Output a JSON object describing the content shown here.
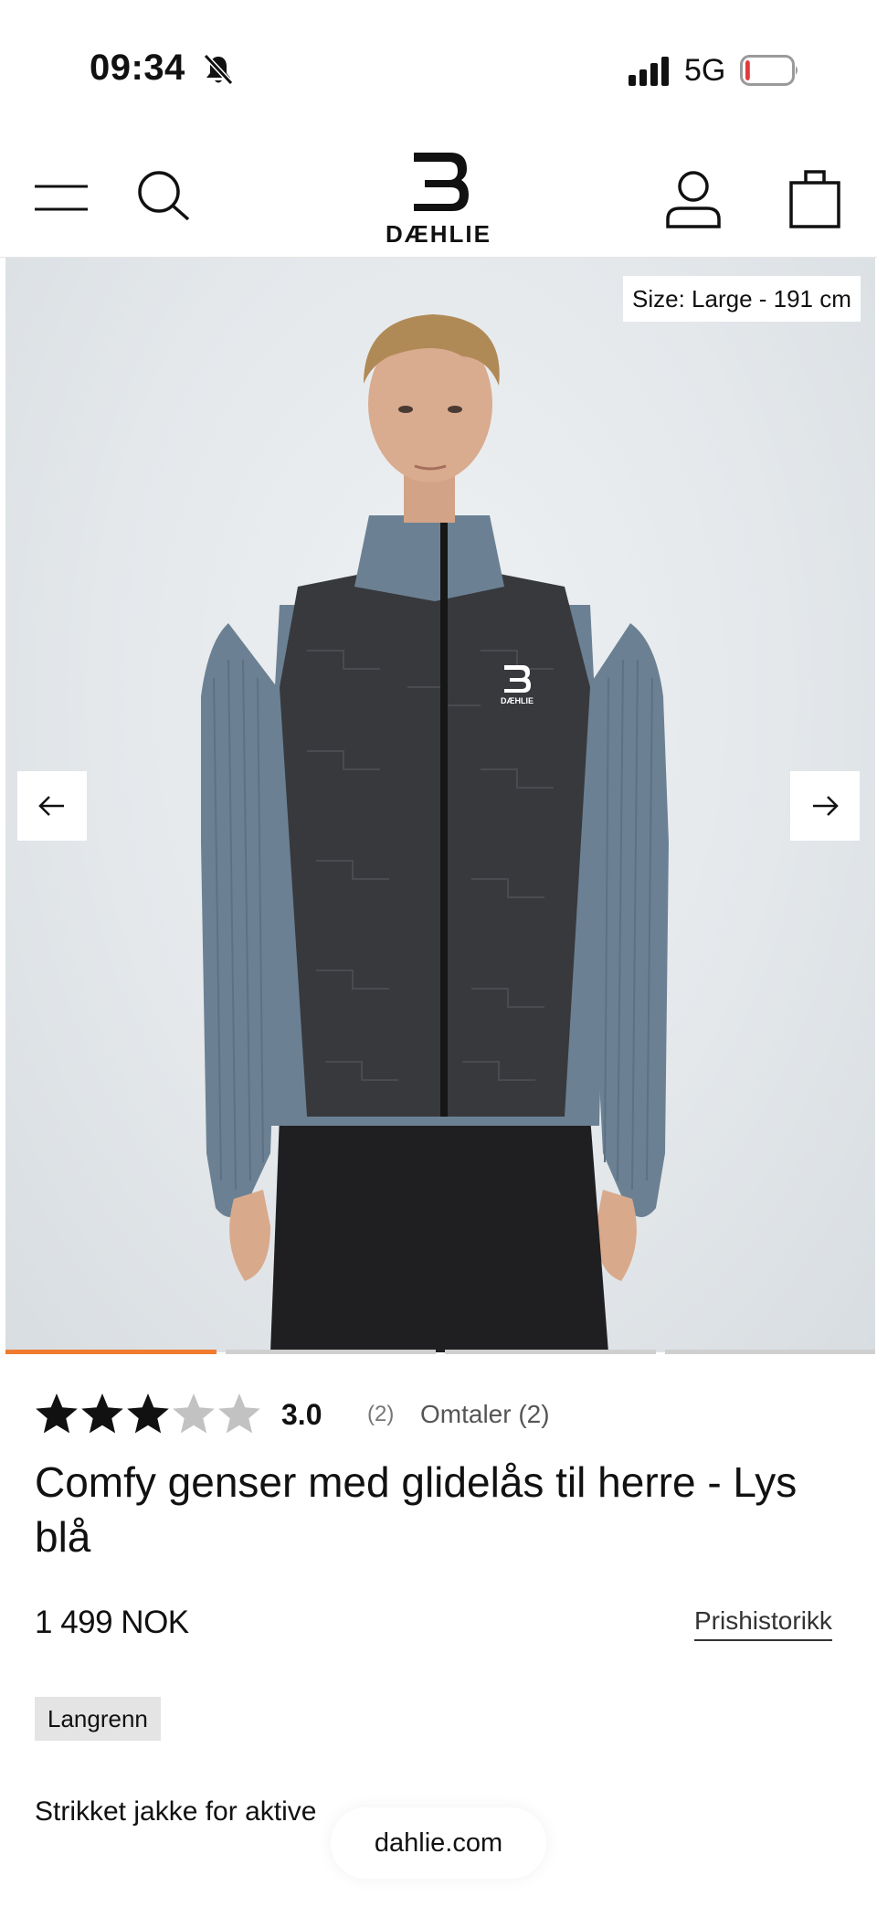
{
  "status_bar": {
    "time": "09:34",
    "network": "5G",
    "battery_level": 0.1,
    "colors": {
      "battery_low": "#e23b3b"
    }
  },
  "header": {
    "logo_text": "DÆHLIE",
    "icons": [
      "menu-icon",
      "search-icon",
      "user-icon",
      "bag-icon"
    ]
  },
  "gallery": {
    "size_label": "Size: Large - 191 cm",
    "slide_count": 4,
    "active_slide": 1,
    "jacket_logo_text": "DÆHLIE",
    "colors": {
      "active_indicator": "#f07b2e",
      "inactive_indicator": "#cfcfcf"
    }
  },
  "product": {
    "rating": 3.0,
    "rating_display": "3.0",
    "rating_max": 5,
    "rating_count": "(2)",
    "reviews_link": "Omtaler (2)",
    "title": "Comfy genser med glidelås til herre - Lys blå",
    "price": "1 499 NOK",
    "price_history_link": "Prishistorikk",
    "tag": "Langrenn",
    "description": "Strikket jakke for aktive"
  },
  "browser": {
    "url": "dahlie.com"
  }
}
